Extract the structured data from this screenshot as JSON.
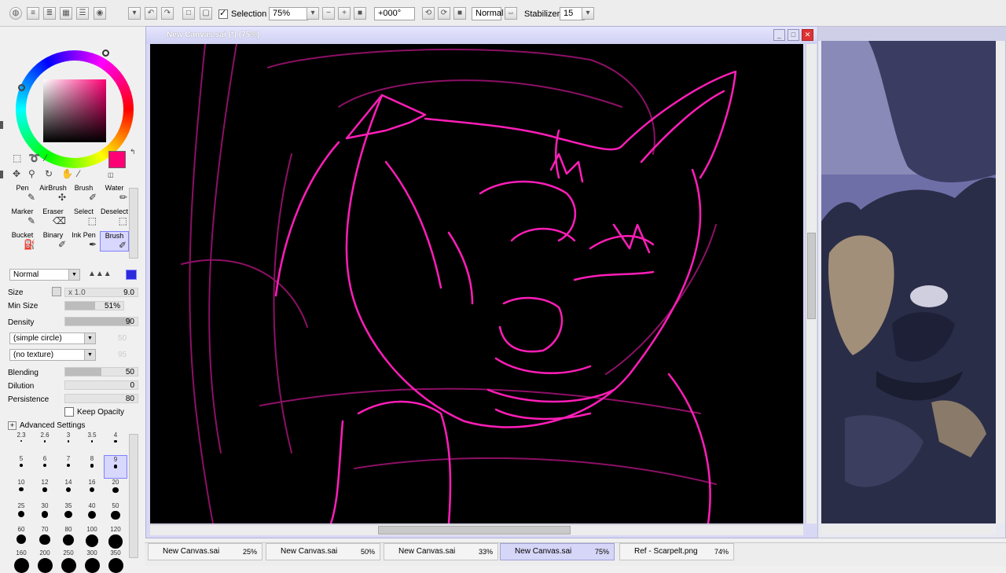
{
  "toolbar": {
    "selection_label": "Selection",
    "zoom": "75%",
    "rotation": "+000°",
    "blend_mode": "Normal",
    "stabilizer_label": "Stabilizer",
    "stabilizer_value": "15"
  },
  "canvas_window": {
    "title": "New Canvas.sai (*) (75%)"
  },
  "colors": {
    "current": "#ff0075",
    "stroke": "#ff1eb8"
  },
  "tools": {
    "items": [
      {
        "label": "Pen"
      },
      {
        "label": "AirBrush"
      },
      {
        "label": "Brush"
      },
      {
        "label": "Water"
      },
      {
        "label": "Marker"
      },
      {
        "label": "Eraser"
      },
      {
        "label": "Select"
      },
      {
        "label": "Deselect"
      },
      {
        "label": "Bucket"
      },
      {
        "label": "Binary"
      },
      {
        "label": "Ink Pen"
      },
      {
        "label": "Brush"
      }
    ]
  },
  "brush": {
    "mode": "Normal",
    "size_label": "Size",
    "size_multiplier": "x 1.0",
    "size_value": "9.0",
    "min_size_label": "Min Size",
    "min_size_value": "51%",
    "density_label": "Density",
    "density_value": "90",
    "shape": "(simple circle)",
    "shape_value": "50",
    "texture": "(no texture)",
    "texture_value": "95",
    "blending_label": "Blending",
    "blending_value": "50",
    "dilution_label": "Dilution",
    "dilution_value": "0",
    "persistence_label": "Persistence",
    "persistence_value": "80",
    "keep_opacity_label": "Keep Opacity",
    "advanced_label": "Advanced Settings"
  },
  "brush_sizes": [
    "2.3",
    "2.6",
    "3",
    "3.5",
    "4",
    "5",
    "6",
    "7",
    "8",
    "9",
    "10",
    "12",
    "14",
    "16",
    "20",
    "25",
    "30",
    "35",
    "40",
    "50",
    "60",
    "70",
    "80",
    "100",
    "120",
    "160",
    "200",
    "250",
    "300",
    "350"
  ],
  "tabs": [
    {
      "label": "New Canvas.sai",
      "zoom": "25%"
    },
    {
      "label": "New Canvas.sai",
      "zoom": "50%"
    },
    {
      "label": "New Canvas.sai",
      "zoom": "33%"
    },
    {
      "label": "New Canvas.sai",
      "zoom": "75%"
    },
    {
      "label": "Ref - Scarpelt.png",
      "zoom": "74%"
    }
  ]
}
